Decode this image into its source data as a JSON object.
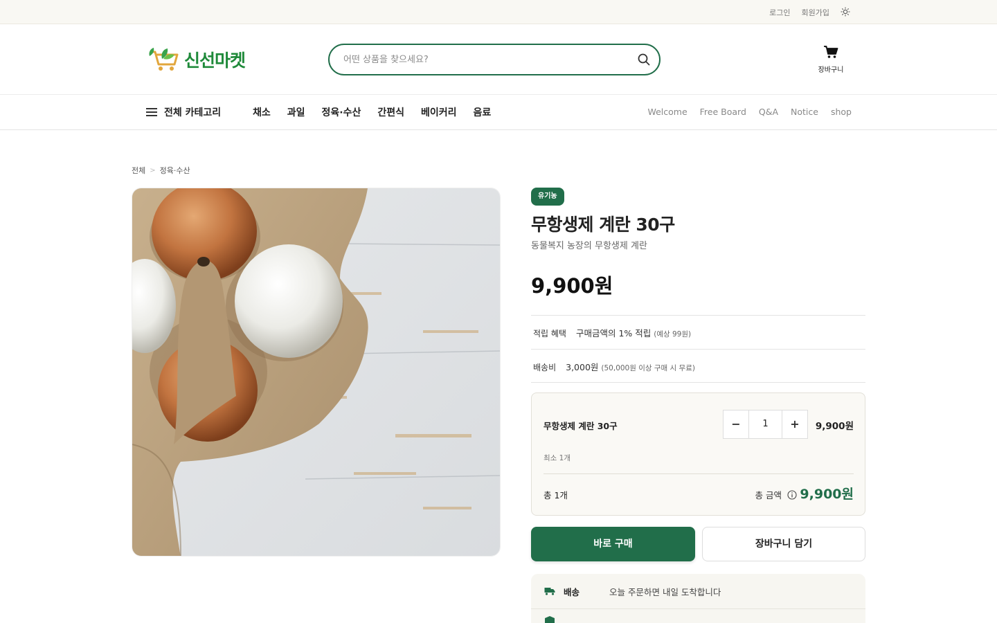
{
  "topbar": {
    "login": "로그인",
    "signup": "회원가입"
  },
  "header": {
    "logo_text": "신선마켓",
    "search_placeholder": "어떤 상품을 찾으세요?",
    "cart_label": "장바구니"
  },
  "nav": {
    "all_categories": "전체 카테고리",
    "categories": [
      "채소",
      "과일",
      "정육·수산",
      "간편식",
      "베이커리",
      "음료"
    ],
    "boards": [
      "Welcome",
      "Free Board",
      "Q&A",
      "Notice",
      "shop"
    ]
  },
  "breadcrumb": [
    "전체",
    "정육·수산"
  ],
  "breadcrumb_sep": ">",
  "product": {
    "badge": "유기농",
    "title": "무항생제 계란 30구",
    "subtitle": "동물복지 농장의 무항생제 계란",
    "price": "9,900원",
    "points_label": "적립 혜택",
    "points_value": "구매금액의 1% 적립",
    "points_note": "(예상 99원)",
    "shipping_label": "배송비",
    "shipping_value": "3,000원",
    "shipping_note": "(50,000원 이상 구매 시 무료)"
  },
  "option": {
    "name": "무항생제 계란 30구",
    "minus": "−",
    "quantity": "1",
    "plus": "+",
    "price": "9,900원",
    "min_note": "최소 1개",
    "total_qty": "총 1개",
    "total_label": "총 금액",
    "total_price": "9,900원"
  },
  "actions": {
    "buy_now": "바로 구매",
    "add_to_cart": "장바구니 담기"
  },
  "shipping_info": [
    {
      "icon": "truck-icon",
      "label": "배송",
      "value": "오늘 주문하면 내일 도착합니다"
    },
    {
      "icon": "box-icon",
      "label": "",
      "value": ""
    }
  ],
  "colors": {
    "primary": "#216e4a",
    "logo_green": "#1f8a3a",
    "topbar_bg": "#f9f8f3"
  }
}
